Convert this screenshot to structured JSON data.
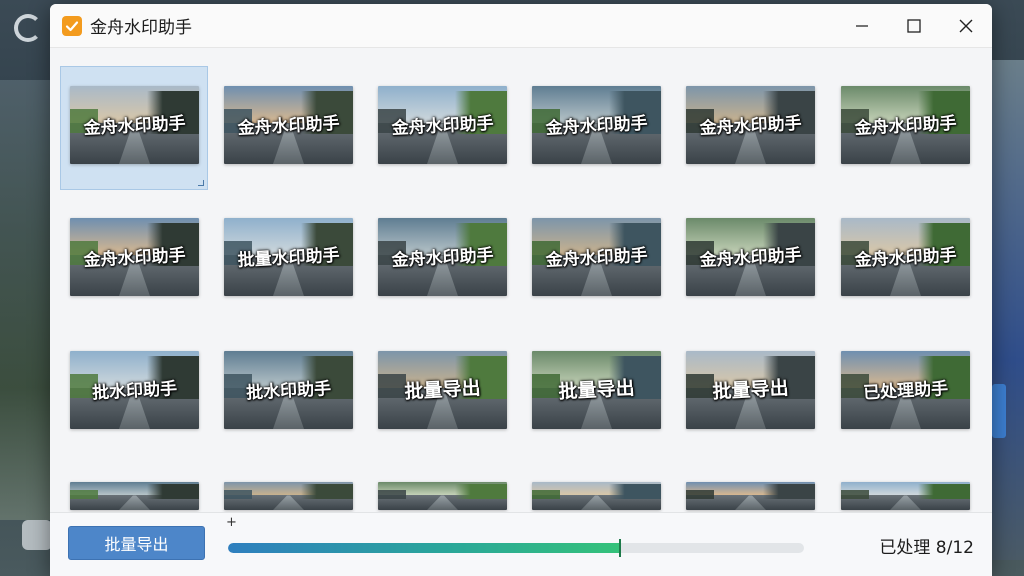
{
  "window": {
    "title": "金舟水印助手",
    "controls": {
      "minimize": "minimize-icon",
      "maximize": "maximize-icon",
      "close": "close-icon"
    }
  },
  "grid": {
    "rows": [
      [
        "金舟水印助手",
        "金舟水印助手",
        "金舟水印助手",
        "金舟水印助手",
        "金舟水印助手",
        "金舟水印助手"
      ],
      [
        "金舟水印助手",
        "批量水印助手",
        "金舟水印助手",
        "金舟水印助手",
        "金舟水印助手",
        "金舟水印助手"
      ],
      [
        "批水印助手",
        "批水印助手",
        "批量导出",
        "批量导出",
        "批量导出",
        "已处理助手"
      ],
      [
        "",
        "",
        "",
        "",
        "",
        ""
      ]
    ]
  },
  "footer": {
    "export_label": "批量导出",
    "plus": "+",
    "progress": 0.68,
    "status": "已处理 8/12"
  },
  "colors": {
    "accent": "#4d86c9",
    "app_icon": "#f39b1e",
    "progress_end": "#35c27a"
  }
}
